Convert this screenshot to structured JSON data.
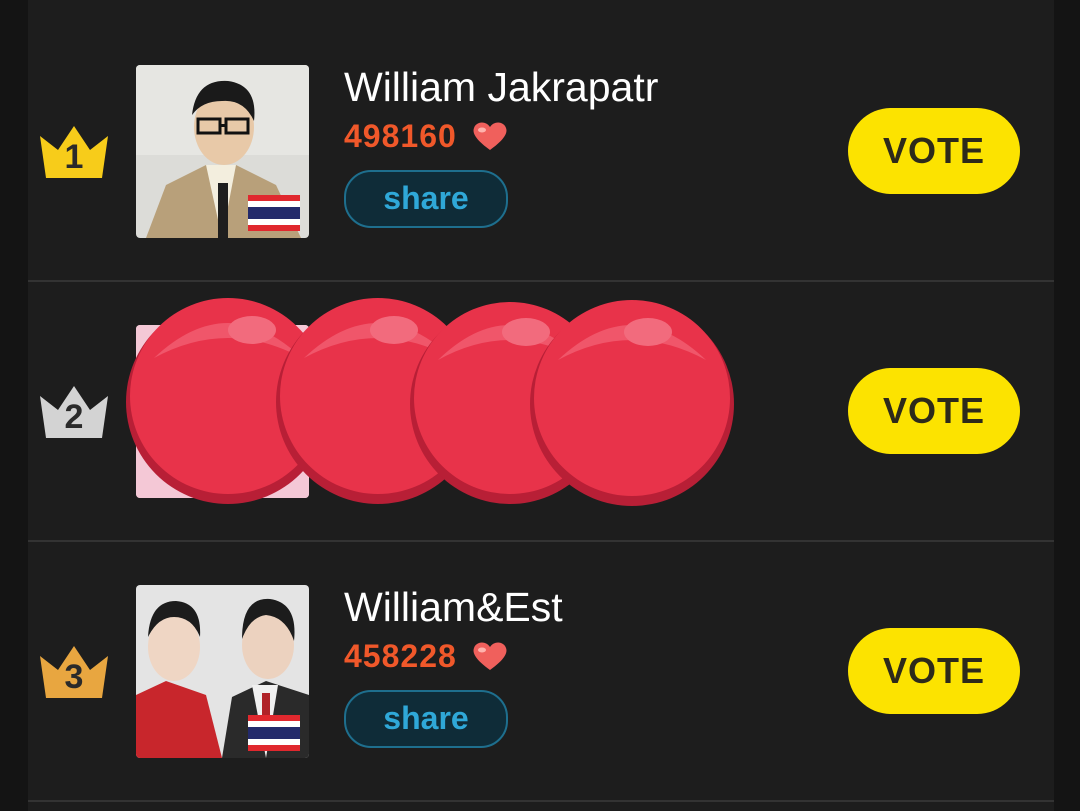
{
  "entries": [
    {
      "rank": "1",
      "name": "William Jakrapatr",
      "votes": "498160",
      "share_label": "share",
      "vote_label": "VOTE",
      "crown_color": "#f7cc1a",
      "flag": "thailand-flag-icon"
    },
    {
      "rank": "2",
      "name": "",
      "votes": "",
      "share_label": "",
      "vote_label": "VOTE",
      "crown_color": "#d3d3d3",
      "flag": "thailand-flag-icon"
    },
    {
      "rank": "3",
      "name": "William&Est",
      "votes": "458228",
      "share_label": "share",
      "vote_label": "VOTE",
      "crown_color": "#e8a640",
      "flag": "thailand-flag-icon"
    }
  ],
  "colors": {
    "vote_button": "#fce300",
    "votes_text": "#f0582a",
    "share_text": "#2fa8d8",
    "heart": "#f0605c",
    "redaction_blob": "#e8334a"
  },
  "icons": [
    "crown-icon",
    "heart-icon",
    "thailand-flag-icon",
    "redaction-sticker"
  ]
}
